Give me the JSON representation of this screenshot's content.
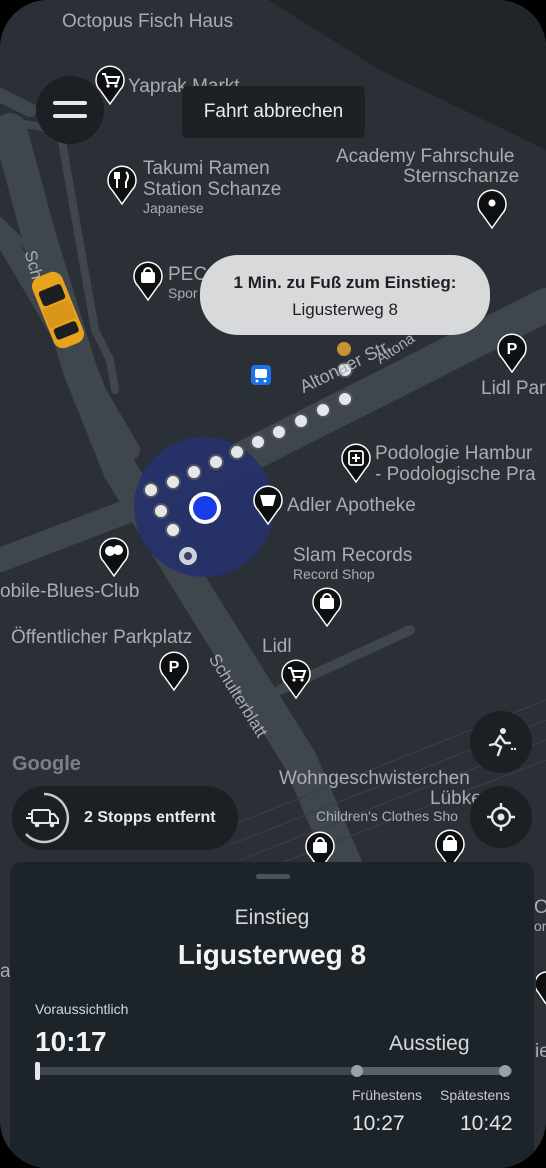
{
  "map": {
    "labels": {
      "octopus": "Octopus Fisch Haus",
      "yaprak": "Yaprak Markt",
      "takumi_1": "Takumi Ramen",
      "takumi_2": "Station Schanze",
      "takumi_sub": "Japanese",
      "academy_1": "Academy Fahrschule",
      "academy_2": "Sternschanze",
      "pec": "PEC",
      "pec_sub": "Spor",
      "lidl_park": "Lidl Par",
      "altonaer_str": "Altonaer Str.",
      "altona": "Altona",
      "podologie_1": "Podologie Hambur",
      "podologie_2": "- Podologische Pra",
      "adler": "Adler Apotheke",
      "slam": "Slam Records",
      "slam_sub": "Record Shop",
      "blues": "obile-Blues-Club",
      "parkplatz": "Öffentlicher Parkplatz",
      "lidl": "Lidl",
      "schulterblatt": "Schulterblatt",
      "schulterblatt_top": "Sch",
      "google": "Google",
      "wohn_1": "Wohngeschwisterchen",
      "wohn_2": "Lübke",
      "wohn_sub": "Children's Clothes Sho"
    }
  },
  "toast": {
    "cancel_ride": "Fahrt abbrechen"
  },
  "bubble": {
    "line1": "1 Min. zu Fuß zum Einstieg:",
    "line2": "Ligusterweg 8"
  },
  "stops_pill": {
    "label": "2 Stopps entfernt"
  },
  "sheet": {
    "pickup_label": "Einstieg",
    "pickup_address": "Ligusterweg 8",
    "expected_label": "Voraussichtlich",
    "expected_time": "10:17",
    "dropoff_label": "Ausstieg",
    "earliest_label": "Frühestens",
    "latest_label": "Spätestens",
    "earliest_time": "10:27",
    "latest_time": "10:42"
  },
  "edge_fragments": {
    "left": "a",
    "right_top": "O",
    "right_mid": "or",
    "right_bottom": "ie"
  },
  "colors": {
    "map_bg": "#2b3036",
    "road": "#40464d",
    "user_dot": "#1a3be8",
    "accuracy": "#26326a",
    "taxi": "#e8a31c",
    "bubble": "#d8d9db",
    "sheet": "#1c2329"
  }
}
